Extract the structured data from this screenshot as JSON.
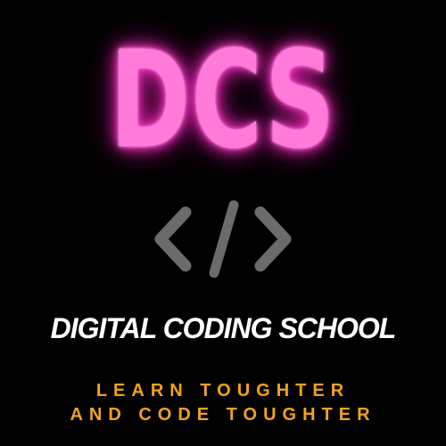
{
  "logo": {
    "text": "DCS",
    "color": "#ff7ad9",
    "glow_color": "#ff2fc4"
  },
  "icon": {
    "name": "code-brackets-icon",
    "color": "#6b6b6b"
  },
  "title": "DIGITAL CODING SCHOOL",
  "tagline": {
    "line1": "LEARN TOUGHTER",
    "line2": "AND CODE TOUGHTER",
    "color": "#f0a21c"
  },
  "background": "#000000"
}
